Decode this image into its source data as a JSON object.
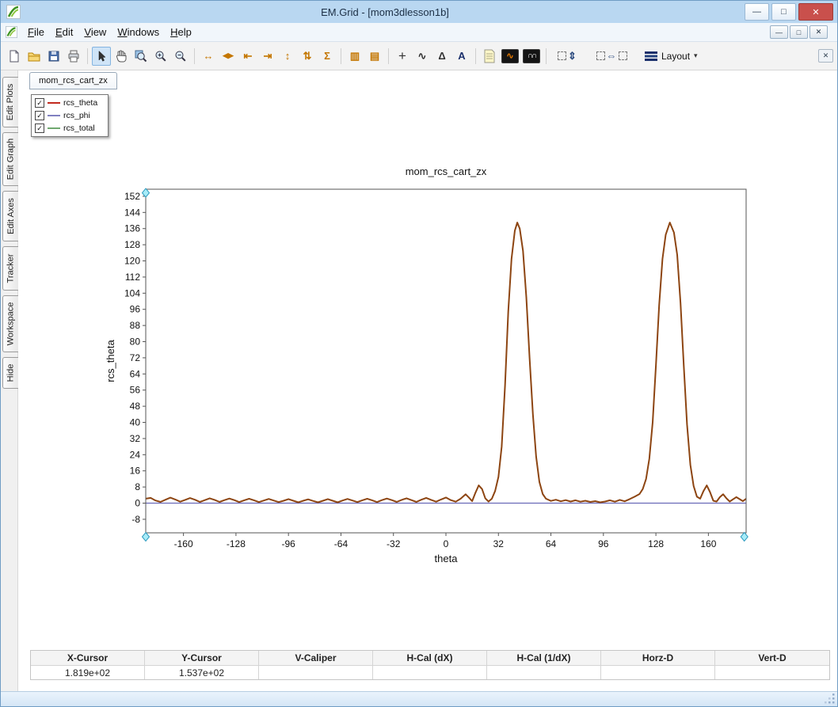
{
  "window": {
    "title": "EM.Grid - [mom3dlesson1b]",
    "controls": {
      "minimize": "—",
      "maximize": "□",
      "close": "✕"
    }
  },
  "menubar": {
    "items": [
      {
        "key": "F",
        "rest": "ile"
      },
      {
        "key": "E",
        "rest": "dit"
      },
      {
        "key": "V",
        "rest": "iew"
      },
      {
        "key": "W",
        "rest": "indows"
      },
      {
        "key": "H",
        "rest": "elp"
      }
    ],
    "mdi": {
      "minimize": "—",
      "restore": "□",
      "close": "✕"
    }
  },
  "toolbar": {
    "glyphs": {
      "fit_width": "↔",
      "pan_x": "◀▶",
      "shift_left": "⇤",
      "shift_right": "⇥",
      "fit_height": "↕",
      "pan_y": "⇅",
      "sigma": "Σ",
      "stack_v": "▥",
      "stack_h": "▤",
      "crosshair": "+",
      "tracker": "∿",
      "delta": "Δ",
      "text": "A",
      "fft": "∿",
      "smooth": "∩∩",
      "arrange_v": "⇕",
      "arrange_h": "⇔"
    },
    "layout_label": "Layout",
    "layout_caret": "▾",
    "close": "✕"
  },
  "sidebar": {
    "tabs": [
      "Edit Plots",
      "Edit Graph",
      "Edit Axes",
      "Tracker",
      "Workspace",
      "Hide"
    ]
  },
  "document_tab": "mom_rcs_cart_zx",
  "legend": {
    "check": "✓",
    "items": [
      {
        "label": "rcs_theta",
        "checked": true,
        "color": "#c22a1e"
      },
      {
        "label": "rcs_phi",
        "checked": true,
        "color": "#8080c0"
      },
      {
        "label": "rcs_total",
        "checked": true,
        "color": "#6fa86f"
      }
    ]
  },
  "cursor_table": {
    "headers": [
      "X-Cursor",
      "Y-Cursor",
      "V-Caliper",
      "H-Cal (dX)",
      "H-Cal (1/dX)",
      "Horz-D",
      "Vert-D"
    ],
    "values": [
      "1.819e+02",
      "1.537e+02",
      "",
      "",
      "",
      "",
      ""
    ]
  },
  "chart_data": {
    "type": "line",
    "title": "mom_rcs_cart_zx",
    "xlabel": "theta",
    "ylabel": "rcs_theta",
    "xlim": [
      -183,
      183
    ],
    "ylim": [
      -14.7,
      155.5
    ],
    "xticks": [
      -160,
      -128,
      -96,
      -64,
      -32,
      0,
      32,
      64,
      96,
      128,
      160
    ],
    "yticks": [
      152,
      144,
      136,
      128,
      120,
      112,
      104,
      96,
      88,
      80,
      72,
      64,
      56,
      48,
      40,
      32,
      24,
      16,
      8,
      0,
      -8
    ],
    "grid": false,
    "legend_position": "floating-top-left",
    "cursors": {
      "x": 181.9,
      "y": 153.7
    },
    "series": [
      {
        "name": "rcs_phi",
        "color": "#6a6ab8",
        "width": 1.3,
        "points": [
          [
            -183,
            0
          ],
          [
            183,
            0
          ]
        ]
      },
      {
        "name": "rcs_total",
        "color": "#4e8f4e",
        "width": 1,
        "same_as": "rcs_theta"
      },
      {
        "name": "rcs_theta",
        "color": "#8d4512",
        "width": 2,
        "points": [
          [
            -183,
            2.2
          ],
          [
            -180,
            2.6
          ],
          [
            -177,
            1.3
          ],
          [
            -174,
            0.6
          ],
          [
            -171,
            1.7
          ],
          [
            -168,
            2.7
          ],
          [
            -165,
            1.8
          ],
          [
            -162,
            0.7
          ],
          [
            -159,
            1.6
          ],
          [
            -156,
            2.5
          ],
          [
            -153,
            1.7
          ],
          [
            -150,
            0.6
          ],
          [
            -147,
            1.5
          ],
          [
            -144,
            2.4
          ],
          [
            -141,
            1.6
          ],
          [
            -138,
            0.6
          ],
          [
            -135,
            1.5
          ],
          [
            -132,
            2.3
          ],
          [
            -129,
            1.5
          ],
          [
            -126,
            0.5
          ],
          [
            -123,
            1.4
          ],
          [
            -120,
            2.2
          ],
          [
            -117,
            1.4
          ],
          [
            -114,
            0.5
          ],
          [
            -111,
            1.3
          ],
          [
            -108,
            2.1
          ],
          [
            -105,
            1.3
          ],
          [
            -102,
            0.5
          ],
          [
            -99,
            1.2
          ],
          [
            -96,
            2.0
          ],
          [
            -93,
            1.2
          ],
          [
            -90,
            0.4
          ],
          [
            -87,
            1.2
          ],
          [
            -84,
            1.9
          ],
          [
            -81,
            1.1
          ],
          [
            -78,
            0.4
          ],
          [
            -75,
            1.2
          ],
          [
            -72,
            2.0
          ],
          [
            -69,
            1.2
          ],
          [
            -66,
            0.4
          ],
          [
            -63,
            1.3
          ],
          [
            -60,
            2.1
          ],
          [
            -57,
            1.3
          ],
          [
            -54,
            0.5
          ],
          [
            -51,
            1.4
          ],
          [
            -48,
            2.2
          ],
          [
            -45,
            1.4
          ],
          [
            -42,
            0.5
          ],
          [
            -39,
            1.5
          ],
          [
            -36,
            2.3
          ],
          [
            -33,
            1.5
          ],
          [
            -30,
            0.6
          ],
          [
            -27,
            1.6
          ],
          [
            -24,
            2.4
          ],
          [
            -21,
            1.5
          ],
          [
            -18,
            0.6
          ],
          [
            -15,
            1.7
          ],
          [
            -12,
            2.6
          ],
          [
            -9,
            1.6
          ],
          [
            -6,
            0.7
          ],
          [
            -3,
            1.8
          ],
          [
            0,
            2.8
          ],
          [
            3,
            1.5
          ],
          [
            6,
            0.7
          ],
          [
            9,
            2.2
          ],
          [
            12,
            4.4
          ],
          [
            14,
            2.8
          ],
          [
            16,
            1.0
          ],
          [
            18,
            5.2
          ],
          [
            20,
            8.8
          ],
          [
            22,
            7.0
          ],
          [
            24,
            2.4
          ],
          [
            26,
            0.8
          ],
          [
            28,
            2.2
          ],
          [
            30,
            6.0
          ],
          [
            32,
            13.0
          ],
          [
            34,
            28.0
          ],
          [
            36,
            58.0
          ],
          [
            38,
            95.0
          ],
          [
            40,
            121.0
          ],
          [
            42,
            135.0
          ],
          [
            43.5,
            139.0
          ],
          [
            45,
            136.0
          ],
          [
            47,
            125.0
          ],
          [
            49,
            102.0
          ],
          [
            51,
            72.0
          ],
          [
            53,
            44.0
          ],
          [
            55,
            23.0
          ],
          [
            57,
            10.5
          ],
          [
            59,
            4.5
          ],
          [
            61,
            2.2
          ],
          [
            64,
            1.1
          ],
          [
            67,
            1.7
          ],
          [
            70,
            0.9
          ],
          [
            73,
            1.5
          ],
          [
            76,
            0.8
          ],
          [
            79,
            1.4
          ],
          [
            82,
            0.7
          ],
          [
            85,
            1.2
          ],
          [
            88,
            0.6
          ],
          [
            91,
            1.0
          ],
          [
            94,
            0.4
          ],
          [
            97,
            0.8
          ],
          [
            100,
            1.4
          ],
          [
            103,
            0.7
          ],
          [
            106,
            1.6
          ],
          [
            109,
            0.9
          ],
          [
            112,
            2.0
          ],
          [
            115,
            3.2
          ],
          [
            118,
            4.5
          ],
          [
            120,
            7.0
          ],
          [
            122,
            12.0
          ],
          [
            124,
            22.0
          ],
          [
            126,
            40.0
          ],
          [
            128,
            68.0
          ],
          [
            130,
            98.0
          ],
          [
            132,
            121.0
          ],
          [
            134,
            133.0
          ],
          [
            136.5,
            139.0
          ],
          [
            139,
            134.0
          ],
          [
            141,
            123.0
          ],
          [
            143,
            99.0
          ],
          [
            145,
            68.0
          ],
          [
            147,
            39.0
          ],
          [
            149,
            19.0
          ],
          [
            151,
            8.5
          ],
          [
            153,
            3.2
          ],
          [
            155,
            2.2
          ],
          [
            157,
            6.0
          ],
          [
            159,
            8.8
          ],
          [
            161,
            5.5
          ],
          [
            163,
            1.2
          ],
          [
            165,
            0.8
          ],
          [
            167,
            3.0
          ],
          [
            169,
            4.4
          ],
          [
            171,
            2.4
          ],
          [
            173,
            0.8
          ],
          [
            175,
            1.9
          ],
          [
            177,
            3.0
          ],
          [
            179,
            2.0
          ],
          [
            181,
            1.0
          ],
          [
            183,
            2.2
          ]
        ]
      }
    ]
  }
}
